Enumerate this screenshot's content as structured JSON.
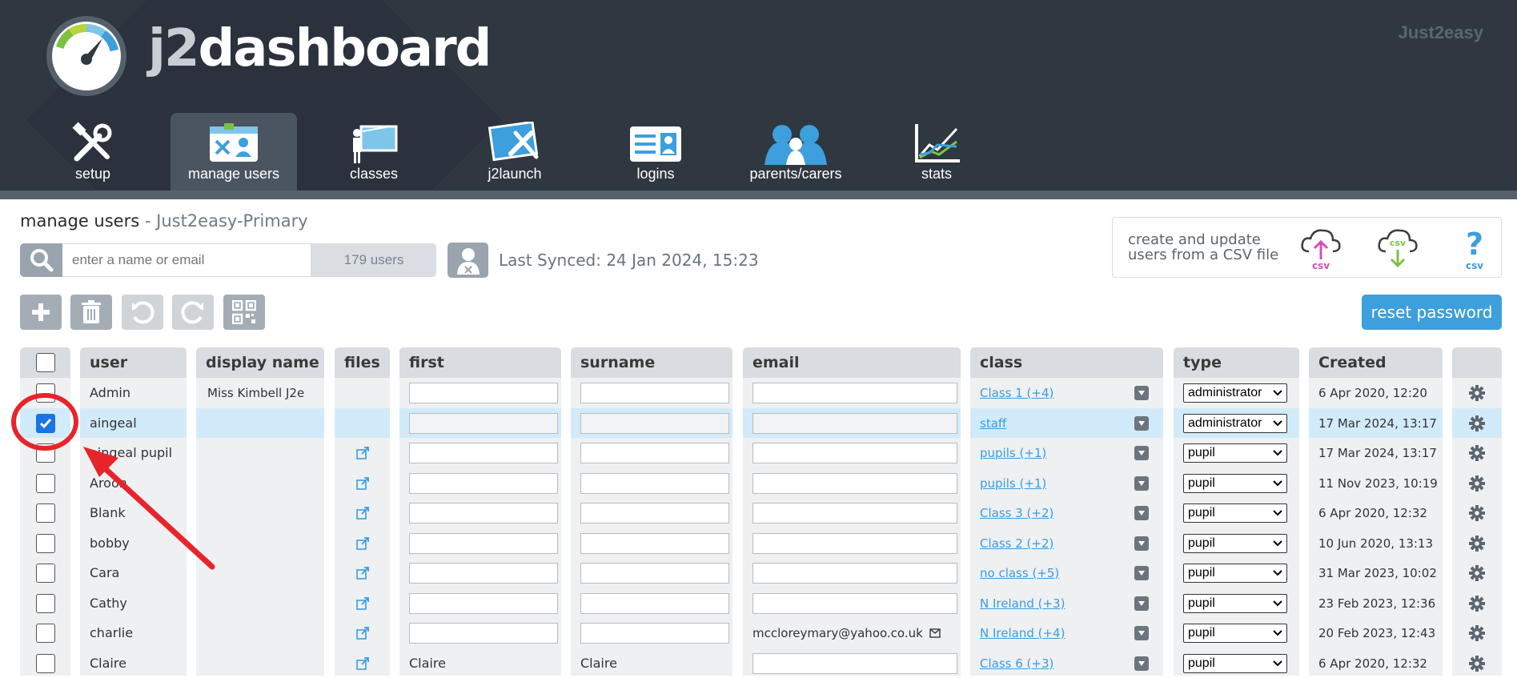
{
  "header": {
    "brand_prefix": "j2",
    "brand_rest": "dashboard",
    "org_name": "Just2easy",
    "nav": [
      {
        "label": "setup",
        "icon": "tools-icon"
      },
      {
        "label": "manage users",
        "icon": "manage-users-icon"
      },
      {
        "label": "classes",
        "icon": "classroom-icon"
      },
      {
        "label": "j2launch",
        "icon": "launch-icon"
      },
      {
        "label": "logins",
        "icon": "id-card-icon"
      },
      {
        "label": "parents/carers",
        "icon": "parents-icon"
      },
      {
        "label": "stats",
        "icon": "chart-icon"
      }
    ],
    "active_nav": "manage users"
  },
  "page": {
    "title": "manage users",
    "separator": " - ",
    "school": "Just2easy-Primary",
    "search_placeholder": "enter a name or email",
    "user_count": "179 users",
    "last_synced": "Last Synced: 24 Jan 2024, 15:23",
    "csv_line1": "create and update",
    "csv_line2": "users from a CSV file",
    "csv_label": "csv",
    "reset_password": "reset password"
  },
  "table": {
    "headers": [
      "user",
      "display name",
      "files",
      "first",
      "surname",
      "email",
      "class",
      "type",
      "Created"
    ],
    "rows": [
      {
        "user": "Admin",
        "display": "Miss Kimbell J2e",
        "files": false,
        "first": "",
        "surname": "",
        "email": "",
        "class": "Class 1 (+4)",
        "type": "administrator",
        "created": "6 Apr 2020, 12:20",
        "checked": false
      },
      {
        "user": "aingeal",
        "display": "",
        "files": false,
        "first": "",
        "surname": "",
        "email": "",
        "class": "staff",
        "type": "administrator",
        "created": "17 Mar 2024, 13:17",
        "checked": true
      },
      {
        "user": "aingeal pupil",
        "display": "",
        "files": true,
        "first": "",
        "surname": "",
        "email": "",
        "class": "pupils (+1)",
        "type": "pupil",
        "created": "17 Mar 2024, 13:17",
        "checked": false
      },
      {
        "user": "Aroon",
        "display": "",
        "files": true,
        "first": "",
        "surname": "",
        "email": "",
        "class": "pupils (+1)",
        "type": "pupil",
        "created": "11 Nov 2023, 10:19",
        "checked": false
      },
      {
        "user": "Blank",
        "display": "",
        "files": true,
        "first": "",
        "surname": "",
        "email": "",
        "class": "Class 3 (+2)",
        "type": "pupil",
        "created": "6 Apr 2020, 12:32",
        "checked": false
      },
      {
        "user": "bobby",
        "display": "",
        "files": true,
        "first": "",
        "surname": "",
        "email": "",
        "class": "Class 2 (+2)",
        "type": "pupil",
        "created": "10 Jun 2020, 13:13",
        "checked": false
      },
      {
        "user": "Cara",
        "display": "",
        "files": true,
        "first": "",
        "surname": "",
        "email": "",
        "class": "no class (+5)",
        "type": "pupil",
        "created": "31 Mar 2023, 10:02",
        "checked": false
      },
      {
        "user": "Cathy",
        "display": "",
        "files": true,
        "first": "",
        "surname": "",
        "email": "",
        "class": "N Ireland (+3)",
        "type": "pupil",
        "created": "23 Feb 2023, 12:36",
        "checked": false
      },
      {
        "user": "charlie",
        "display": "",
        "files": true,
        "first": "",
        "surname": "",
        "email": "mccloreymary@yahoo.co.uk",
        "class": "N Ireland (+4)",
        "type": "pupil",
        "created": "20 Feb 2023, 12:43",
        "checked": false
      },
      {
        "user": "Claire",
        "display": "",
        "files": true,
        "first": "Claire",
        "surname": "Claire",
        "email": "",
        "class": "Class 6 (+3)",
        "type": "pupil",
        "created": "6 Apr 2020, 12:32",
        "checked": false
      }
    ]
  },
  "colors": {
    "header_bg": "#2f3740",
    "accent": "#3d9fdc",
    "selected_row": "#d2ebfb",
    "annotation": "#e8242b"
  }
}
